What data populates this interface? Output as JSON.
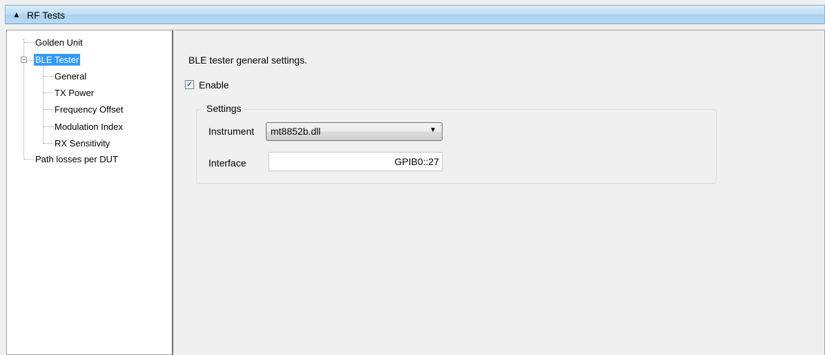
{
  "header": {
    "collapse_icon": "triangle-up",
    "title": "RF Tests"
  },
  "tree": {
    "items": [
      {
        "label": "Golden Unit"
      },
      {
        "label": "BLE Tester",
        "selected": true,
        "expanded": true,
        "children": [
          {
            "label": "General"
          },
          {
            "label": "TX Power"
          },
          {
            "label": "Frequency Offset"
          },
          {
            "label": "Modulation Index"
          },
          {
            "label": "RX Sensitivity"
          }
        ]
      },
      {
        "label": "Path losses per DUT"
      }
    ]
  },
  "main": {
    "description": "BLE tester general settings.",
    "enable": {
      "label": "Enable",
      "checked": true
    },
    "settings": {
      "title": "Settings",
      "instrument_label": "Instrument",
      "instrument_value": "mt8852b.dll",
      "interface_label": "Interface",
      "interface_value": "GPIB0::27"
    }
  },
  "colors": {
    "selection": "#3399ff",
    "header_gradient_top": "#d9ecf9",
    "header_gradient_bottom": "#b8daf2"
  }
}
